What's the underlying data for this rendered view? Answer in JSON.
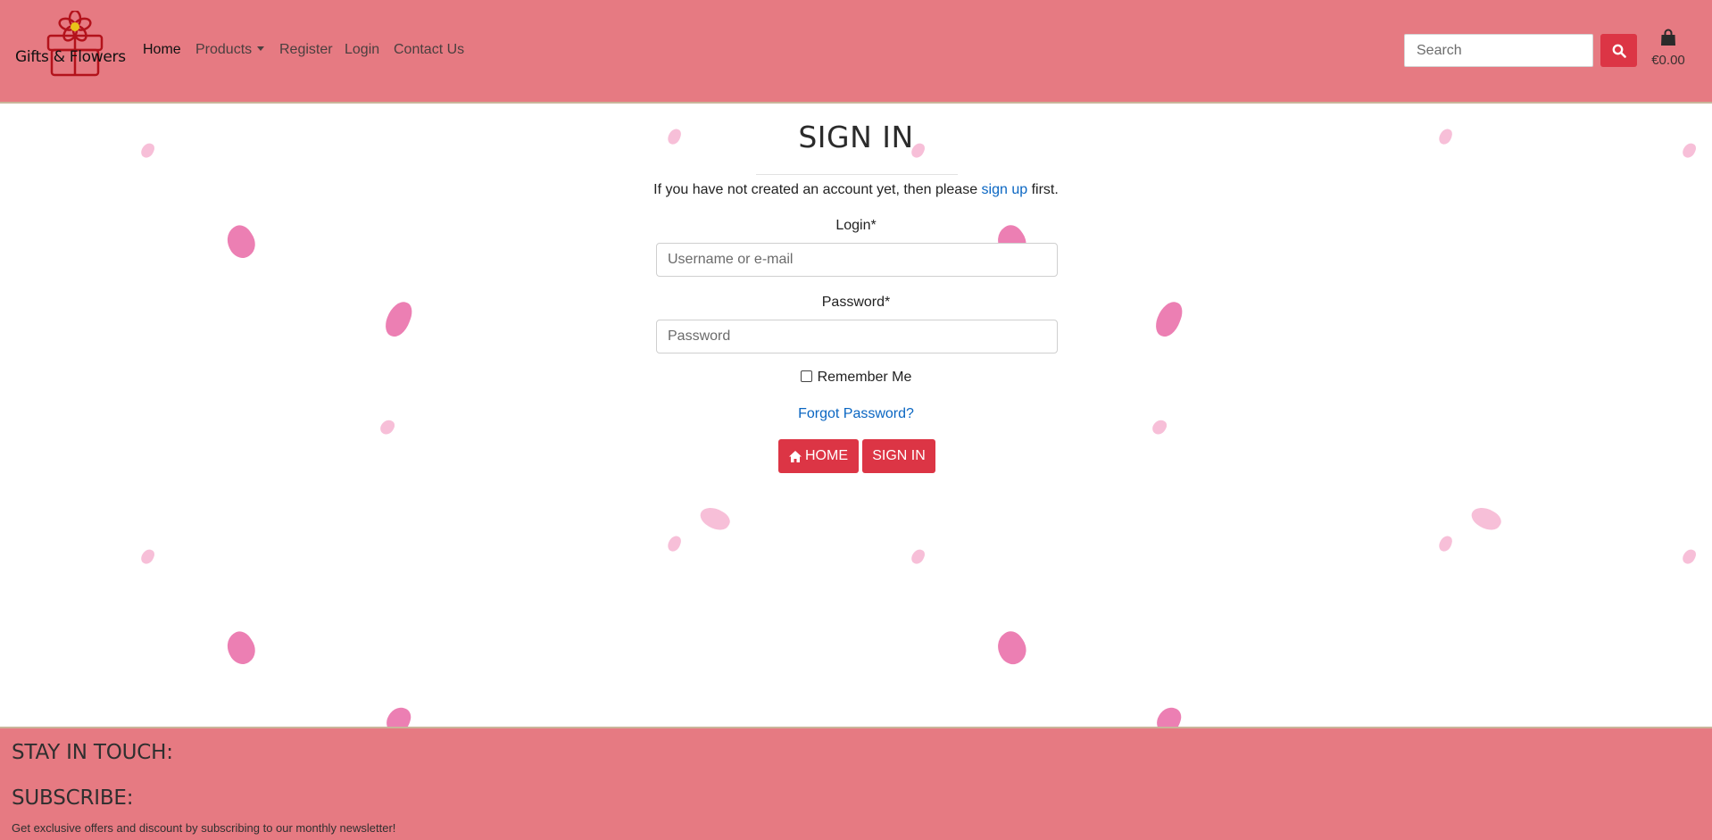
{
  "brand": {
    "name": "Gifts & Flowers"
  },
  "nav": {
    "home": "Home",
    "products": "Products",
    "register": "Register",
    "login": "Login",
    "contact": "Contact Us"
  },
  "search": {
    "placeholder": "Search",
    "icon": "search-icon"
  },
  "cart": {
    "icon": "shopping-bag-icon",
    "total": "€0.00"
  },
  "signin": {
    "title": "SIGN IN",
    "note_prefix": "If you have not created an account yet, then please",
    "note_link": "sign up",
    "note_suffix": "first.",
    "login_label": "Login*",
    "login_placeholder": "Username or e-mail",
    "password_label": "Password*",
    "password_placeholder": "Password",
    "remember_label": "Remember Me",
    "forgot_label": "Forgot Password?",
    "home_button": "HOME",
    "signin_button": "SIGN IN"
  },
  "footer": {
    "stay_in_touch": "STAY IN TOUCH:",
    "subscribe": "SUBSCRIBE:",
    "subscribe_text": "Get exclusive offers and discount by subscribing to our monthly newsletter!"
  },
  "colors": {
    "header_bg": "#e67a82",
    "accent": "#dc3545",
    "link": "#0a66c2",
    "petal_pink": "#ec7fb3",
    "petal_light": "#f7bfd8"
  }
}
